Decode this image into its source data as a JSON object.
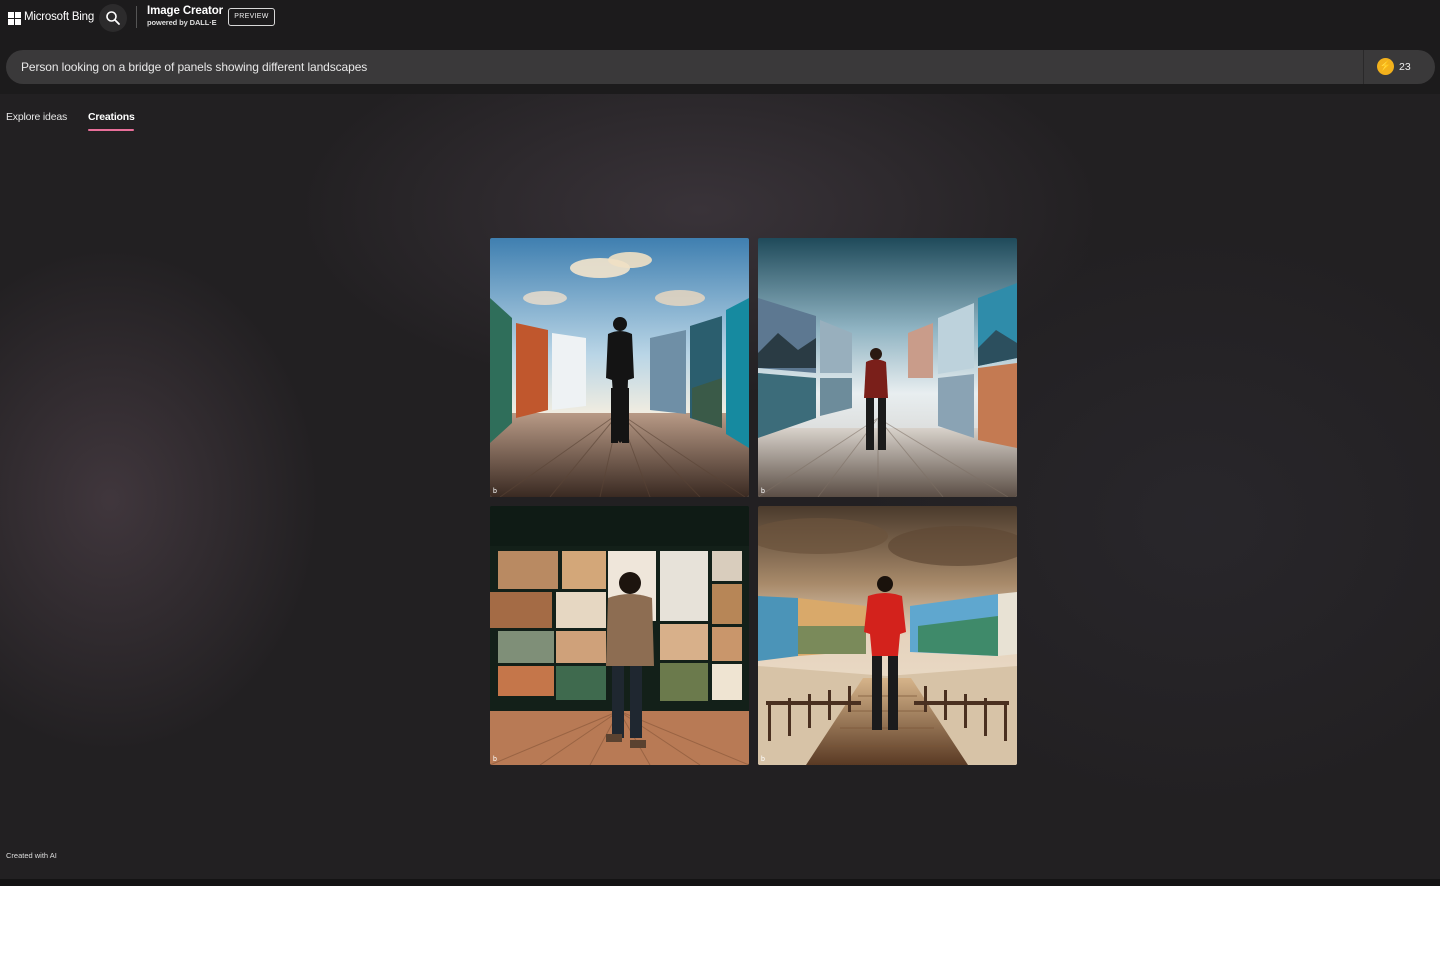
{
  "header": {
    "brand": "Microsoft Bing",
    "app_title": "Image Creator",
    "app_subtitle": "powered by DALL·E",
    "preview_badge": "PREVIEW"
  },
  "prompt": {
    "value": "Person looking on a bridge of panels showing different landscapes"
  },
  "boosts": {
    "count": "23",
    "icon": "lightning-coin-icon",
    "color": "#f2b11c"
  },
  "tabs": [
    {
      "label": "Explore ideas",
      "active": false
    },
    {
      "label": "Creations",
      "active": true
    }
  ],
  "results": {
    "images": [
      {
        "description": "silhouette on wooden deck between landscape panels under bright sky"
      },
      {
        "description": "man in red shirt on misty deck between mountain panels"
      },
      {
        "description": "person in hoodie facing wall of landscape photos"
      },
      {
        "description": "man in red shirt on wooden bridge between panoramic panels"
      }
    ]
  },
  "footer": {
    "note": "Created with AI"
  },
  "colors": {
    "background": "#222022",
    "topbar": "#1c1b1c",
    "prompt_bar": "#3a393a",
    "tab_accent": "#e86f9a"
  }
}
